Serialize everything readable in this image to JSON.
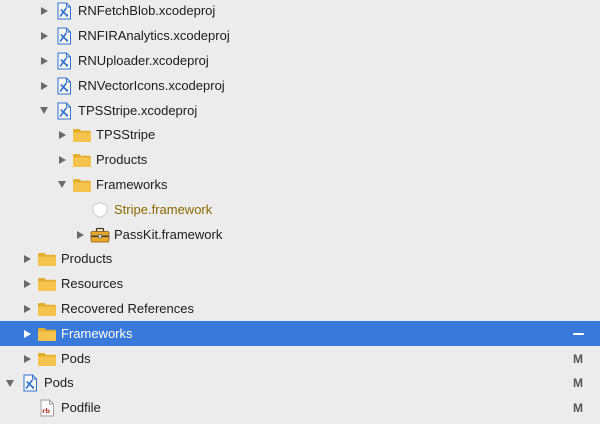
{
  "rows": [
    {
      "key": "rnfetchblob",
      "label": "RNFetchBlob.xcodeproj",
      "icon": "xcodeproj-icon",
      "disclosure": "collapsed",
      "level": 2,
      "status": ""
    },
    {
      "key": "rnfiranalytics",
      "label": "RNFIRAnalytics.xcodeproj",
      "icon": "xcodeproj-icon",
      "disclosure": "collapsed",
      "level": 2,
      "status": ""
    },
    {
      "key": "rnuploader",
      "label": "RNUploader.xcodeproj",
      "icon": "xcodeproj-icon",
      "disclosure": "collapsed",
      "level": 2,
      "status": ""
    },
    {
      "key": "rnvectoricons",
      "label": "RNVectorIcons.xcodeproj",
      "icon": "xcodeproj-icon",
      "disclosure": "collapsed",
      "level": 2,
      "status": ""
    },
    {
      "key": "tpsstripe-xcodeproj",
      "label": "TPSStripe.xcodeproj",
      "icon": "xcodeproj-icon",
      "disclosure": "expanded",
      "level": 2,
      "status": ""
    },
    {
      "key": "tpsstripe-folder",
      "label": "TPSStripe",
      "icon": "folder-icon",
      "disclosure": "collapsed",
      "level": 3,
      "status": ""
    },
    {
      "key": "tpsstripe-products",
      "label": "Products",
      "icon": "folder-icon",
      "disclosure": "collapsed",
      "level": 3,
      "status": ""
    },
    {
      "key": "tpsstripe-frameworks",
      "label": "Frameworks",
      "icon": "folder-icon",
      "disclosure": "expanded",
      "level": 3,
      "status": ""
    },
    {
      "key": "stripe-framework",
      "label": "Stripe.framework",
      "icon": "framework-missing-icon",
      "disclosure": "none",
      "level": 4,
      "status": "",
      "missing": true
    },
    {
      "key": "passkit-framework",
      "label": "PassKit.framework",
      "icon": "toolbox-icon",
      "disclosure": "collapsed",
      "level": 4,
      "status": ""
    },
    {
      "key": "products",
      "label": "Products",
      "icon": "folder-icon",
      "disclosure": "collapsed",
      "level": 1,
      "status": ""
    },
    {
      "key": "resources",
      "label": "Resources",
      "icon": "folder-icon",
      "disclosure": "collapsed",
      "level": 1,
      "status": ""
    },
    {
      "key": "recovered-references",
      "label": "Recovered References",
      "icon": "folder-icon",
      "disclosure": "collapsed",
      "level": 1,
      "status": ""
    },
    {
      "key": "frameworks",
      "label": "Frameworks",
      "icon": "folder-icon",
      "disclosure": "collapsed",
      "level": 1,
      "status": "",
      "selected": true,
      "trailing": "dash"
    },
    {
      "key": "pods-folder",
      "label": "Pods",
      "icon": "folder-icon",
      "disclosure": "collapsed",
      "level": 1,
      "status": "M"
    },
    {
      "key": "pods-project",
      "label": "Pods",
      "icon": "xcodeproj-icon",
      "disclosure": "expanded",
      "level": 0,
      "status": "M"
    },
    {
      "key": "podfile",
      "label": "Podfile",
      "icon": "ruby-file-icon",
      "disclosure": "none",
      "level": 1,
      "status": "M"
    }
  ],
  "colors": {
    "selection": "#3879d9",
    "folder": "#f4c44e",
    "folder_tab": "#e3ad2e",
    "xcodeproj": "#2f6fd0",
    "missing_text": "#8a6a00"
  }
}
